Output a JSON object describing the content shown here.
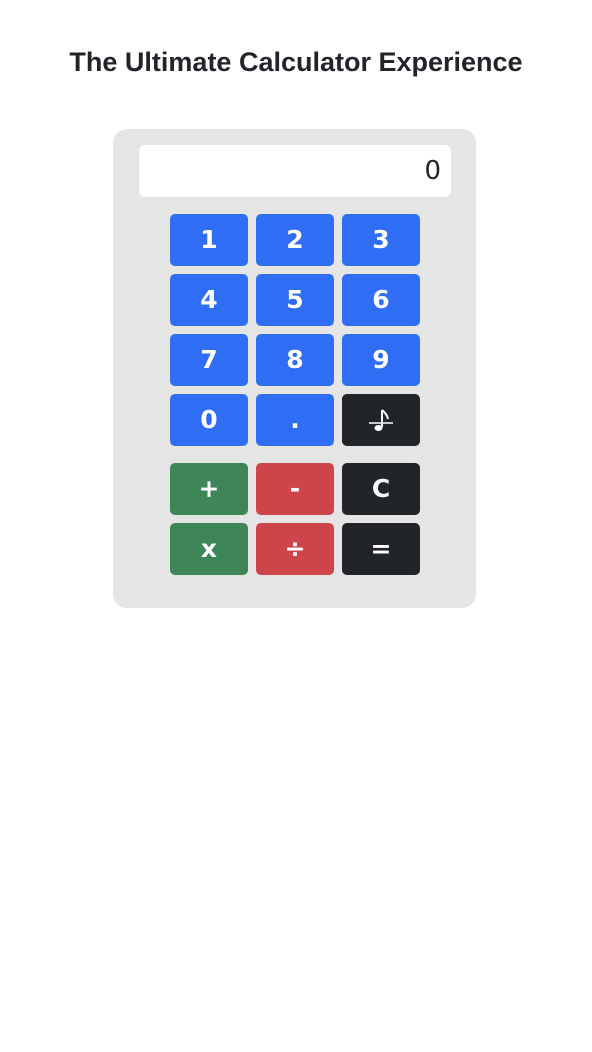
{
  "page": {
    "title": "The Ultimate Calculator Experience"
  },
  "display": {
    "value": "0"
  },
  "keys": {
    "one": "1",
    "two": "2",
    "three": "3",
    "four": "4",
    "five": "5",
    "six": "6",
    "seven": "7",
    "eight": "8",
    "nine": "9",
    "zero": "0",
    "dot": ".",
    "plus": "+",
    "minus": "-",
    "clear": "C",
    "times": "x",
    "divide": "÷",
    "equals": "="
  },
  "icons": {
    "sound_key": "music-note-icon"
  },
  "colors": {
    "digit": "#2f6ef4",
    "add_multiply": "#3e8658",
    "subtract_divide": "#cd454b",
    "control": "#212529",
    "panel": "#e5e5e5"
  }
}
